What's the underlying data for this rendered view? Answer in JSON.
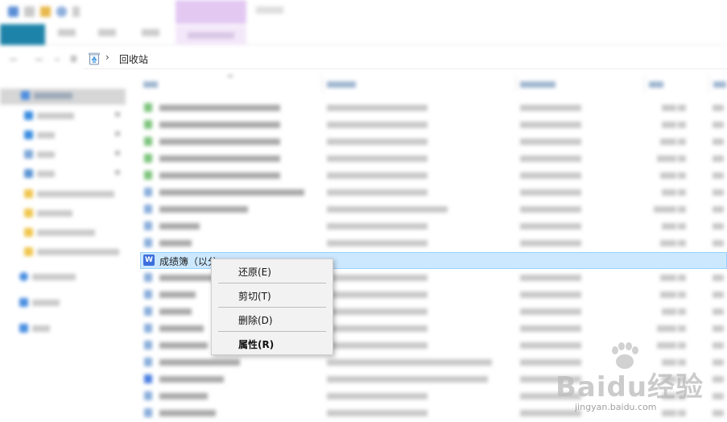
{
  "window": {
    "address": {
      "location": "回收站"
    },
    "context_menu": {
      "items": [
        {
          "label": "还原(E)"
        },
        {
          "label": "剪切(T)"
        },
        {
          "label": "删除(D)"
        },
        {
          "label": "属性(R)"
        }
      ]
    },
    "selected_file": {
      "name": "成绩簿（以分"
    },
    "watermark": {
      "brand": "Baidu经验",
      "url": "jingyan.baidu.com"
    }
  },
  "colors": {
    "selection_bg": "#cce8ff",
    "selection_border": "#99d1ff",
    "menu_bg": "#f2f2f2",
    "file_tab": "#1e83a8",
    "tools_tab": "#e3c9f2"
  }
}
